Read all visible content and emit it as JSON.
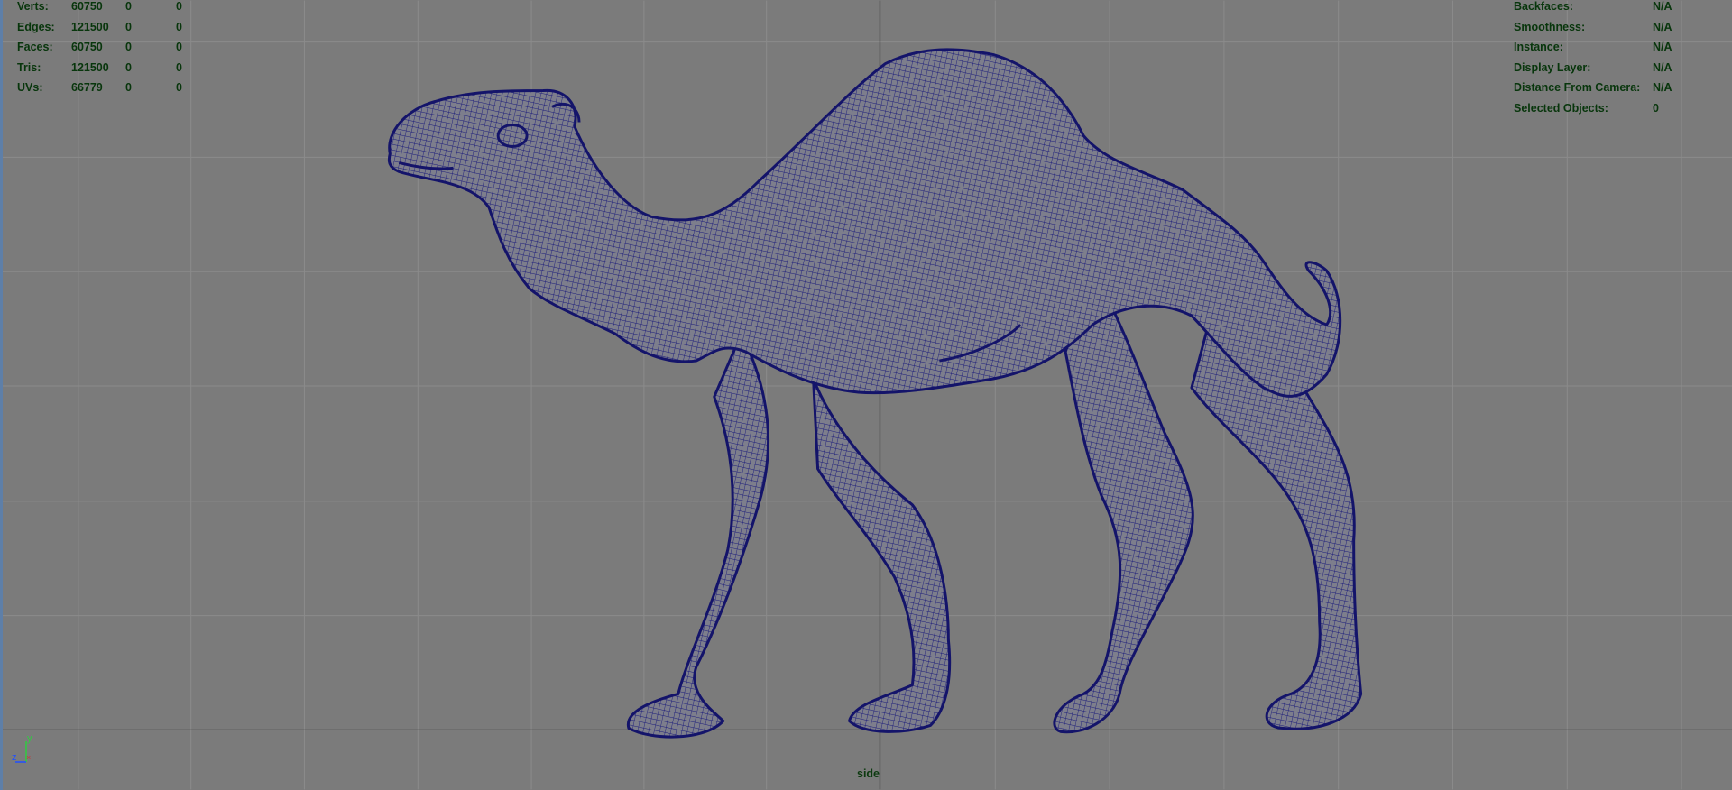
{
  "hud_left": {
    "rows": [
      {
        "label": "Verts:",
        "v1": "60750",
        "v2": "0",
        "v3": "0"
      },
      {
        "label": "Edges:",
        "v1": "121500",
        "v2": "0",
        "v3": "0"
      },
      {
        "label": "Faces:",
        "v1": "60750",
        "v2": "0",
        "v3": "0"
      },
      {
        "label": "Tris:",
        "v1": "121500",
        "v2": "0",
        "v3": "0"
      },
      {
        "label": "UVs:",
        "v1": "66779",
        "v2": "0",
        "v3": "0"
      }
    ]
  },
  "hud_right": {
    "rows": [
      {
        "label": "Backfaces:",
        "value": "N/A"
      },
      {
        "label": "Smoothness:",
        "value": "N/A"
      },
      {
        "label": "Instance:",
        "value": "N/A"
      },
      {
        "label": "Display Layer:",
        "value": "N/A"
      },
      {
        "label": "Distance From Camera:",
        "value": "N/A"
      },
      {
        "label": "Selected Objects:",
        "value": "0"
      }
    ]
  },
  "viewport": {
    "camera_label": "side",
    "axis_labels": {
      "y": "y",
      "z": "z"
    },
    "colors": {
      "background": "#7b7b7b",
      "grid": "#8c8c8c",
      "axis_line": "#0a0a0a",
      "wireframe": "#1b1b7a",
      "hud_text": "#08360c"
    }
  }
}
